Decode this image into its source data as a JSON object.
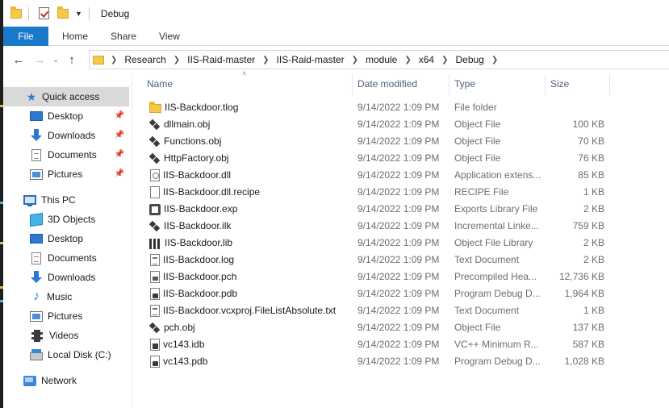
{
  "window": {
    "title": "Debug"
  },
  "ribbon": {
    "tabs": [
      "File",
      "Home",
      "Share",
      "View"
    ]
  },
  "address": {
    "crumbs": [
      "Research",
      "IIS-Raid-master",
      "IIS-Raid-master",
      "module",
      "x64",
      "Debug"
    ]
  },
  "nav": {
    "quick_access": "Quick access",
    "quick_items": [
      "Desktop",
      "Downloads",
      "Documents",
      "Pictures"
    ],
    "this_pc": "This PC",
    "pc_items": [
      "3D Objects",
      "Desktop",
      "Documents",
      "Downloads",
      "Music",
      "Pictures",
      "Videos",
      "Local Disk (C:)"
    ],
    "network": "Network"
  },
  "columns": {
    "name": "Name",
    "date": "Date modified",
    "type": "Type",
    "size": "Size"
  },
  "files": [
    {
      "name": "IIS-Backdoor.tlog",
      "date": "9/14/2022 1:09 PM",
      "type": "File folder",
      "size": "",
      "icon": "folder-icon"
    },
    {
      "name": "dllmain.obj",
      "date": "9/14/2022 1:09 PM",
      "type": "Object File",
      "size": "100 KB",
      "icon": "object-file-icon"
    },
    {
      "name": "Functions.obj",
      "date": "9/14/2022 1:09 PM",
      "type": "Object File",
      "size": "70 KB",
      "icon": "object-file-icon"
    },
    {
      "name": "HttpFactory.obj",
      "date": "9/14/2022 1:09 PM",
      "type": "Object File",
      "size": "76 KB",
      "icon": "object-file-icon"
    },
    {
      "name": "IIS-Backdoor.dll",
      "date": "9/14/2022 1:09 PM",
      "type": "Application extens...",
      "size": "85 KB",
      "icon": "dll-file-icon"
    },
    {
      "name": "IIS-Backdoor.dll.recipe",
      "date": "9/14/2022 1:09 PM",
      "type": "RECIPE File",
      "size": "1 KB",
      "icon": "blank-file-icon"
    },
    {
      "name": "IIS-Backdoor.exp",
      "date": "9/14/2022 1:09 PM",
      "type": "Exports Library File",
      "size": "2 KB",
      "icon": "exports-file-icon"
    },
    {
      "name": "IIS-Backdoor.ilk",
      "date": "9/14/2022 1:09 PM",
      "type": "Incremental Linke...",
      "size": "759 KB",
      "icon": "object-file-icon"
    },
    {
      "name": "IIS-Backdoor.lib",
      "date": "9/14/2022 1:09 PM",
      "type": "Object File Library",
      "size": "2 KB",
      "icon": "library-file-icon"
    },
    {
      "name": "IIS-Backdoor.log",
      "date": "9/14/2022 1:09 PM",
      "type": "Text Document",
      "size": "2 KB",
      "icon": "text-file-icon"
    },
    {
      "name": "IIS-Backdoor.pch",
      "date": "9/14/2022 1:09 PM",
      "type": "Precompiled Hea...",
      "size": "12,736 KB",
      "icon": "pch-file-icon"
    },
    {
      "name": "IIS-Backdoor.pdb",
      "date": "9/14/2022 1:09 PM",
      "type": "Program Debug D...",
      "size": "1,964 KB",
      "icon": "pdb-file-icon"
    },
    {
      "name": "IIS-Backdoor.vcxproj.FileListAbsolute.txt",
      "date": "9/14/2022 1:09 PM",
      "type": "Text Document",
      "size": "1 KB",
      "icon": "text-file-icon"
    },
    {
      "name": "pch.obj",
      "date": "9/14/2022 1:09 PM",
      "type": "Object File",
      "size": "137 KB",
      "icon": "object-file-icon"
    },
    {
      "name": "vc143.idb",
      "date": "9/14/2022 1:09 PM",
      "type": "VC++ Minimum R...",
      "size": "587 KB",
      "icon": "idb-file-icon"
    },
    {
      "name": "vc143.pdb",
      "date": "9/14/2022 1:09 PM",
      "type": "Program Debug D...",
      "size": "1,028 KB",
      "icon": "pdb-file-icon"
    }
  ]
}
